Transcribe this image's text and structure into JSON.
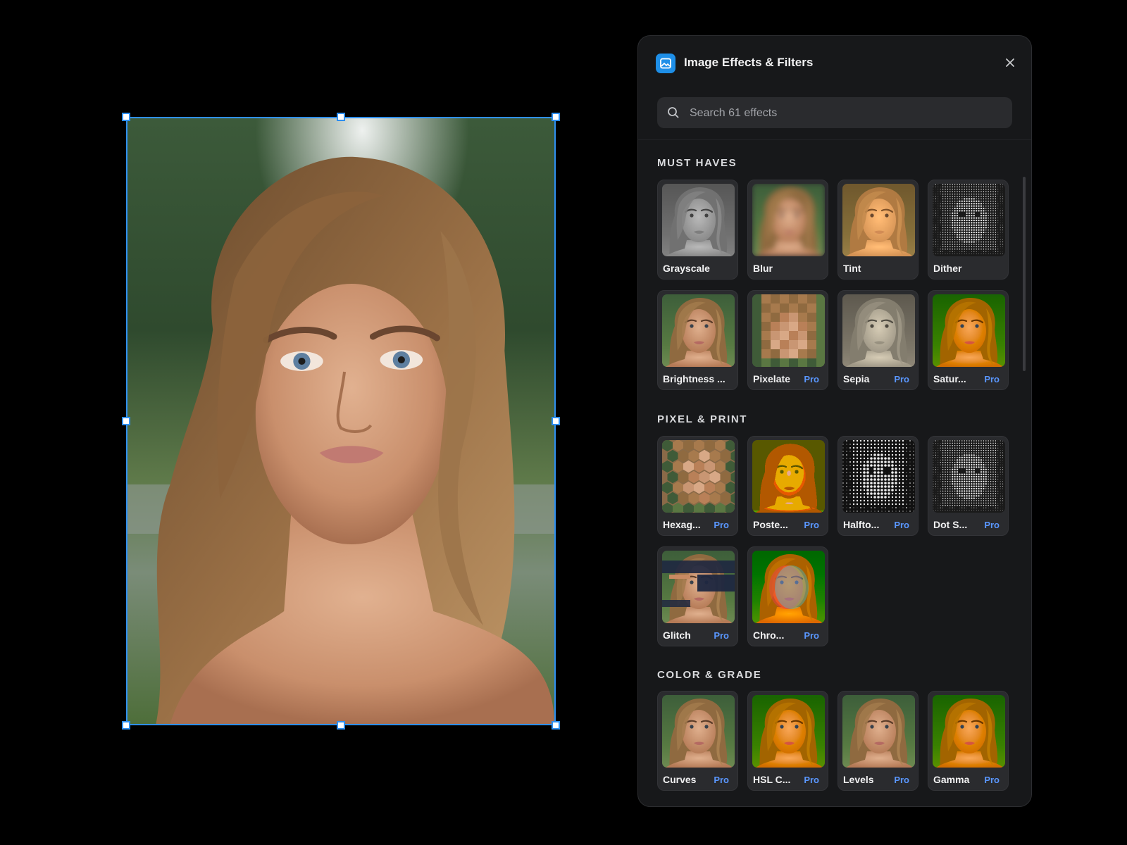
{
  "canvas": {
    "selection_color": "#2f8ff0"
  },
  "panel": {
    "title": "Image Effects & Filters",
    "app_icon": "image-icon",
    "close_icon": "close-icon",
    "search": {
      "placeholder": "Search 61 effects",
      "value": ""
    },
    "accent": "#1e8fe8",
    "pro_color": "#5a97ff"
  },
  "sections": [
    {
      "title": "MUST HAVES",
      "items": [
        {
          "label": "Grayscale",
          "pro": "",
          "filter": "grayscale"
        },
        {
          "label": "Blur",
          "pro": "",
          "filter": "blur"
        },
        {
          "label": "Tint",
          "pro": "",
          "filter": "tint"
        },
        {
          "label": "Dither",
          "pro": "",
          "filter": "dither"
        },
        {
          "label": "Brightness ...",
          "pro": "",
          "filter": "normal"
        },
        {
          "label": "Pixelate",
          "pro": "Pro",
          "filter": "pixelate"
        },
        {
          "label": "Sepia",
          "pro": "Pro",
          "filter": "sepia"
        },
        {
          "label": "Satur...",
          "pro": "Pro",
          "filter": "saturate"
        }
      ]
    },
    {
      "title": "PIXEL & PRINT",
      "items": [
        {
          "label": "Hexag...",
          "pro": "Pro",
          "filter": "hexagon"
        },
        {
          "label": "Poste...",
          "pro": "Pro",
          "filter": "posterize"
        },
        {
          "label": "Halfto...",
          "pro": "Pro",
          "filter": "halftone"
        },
        {
          "label": "Dot S...",
          "pro": "Pro",
          "filter": "dither"
        },
        {
          "label": "Glitch",
          "pro": "Pro",
          "filter": "glitch"
        },
        {
          "label": "Chro...",
          "pro": "Pro",
          "filter": "chroma"
        }
      ]
    },
    {
      "title": "COLOR & GRADE",
      "items": [
        {
          "label": "Curves",
          "pro": "Pro",
          "filter": "normal"
        },
        {
          "label": "HSL C...",
          "pro": "Pro",
          "filter": "saturate"
        },
        {
          "label": "Levels",
          "pro": "Pro",
          "filter": "normal"
        },
        {
          "label": "Gamma",
          "pro": "Pro",
          "filter": "saturate"
        }
      ]
    }
  ]
}
